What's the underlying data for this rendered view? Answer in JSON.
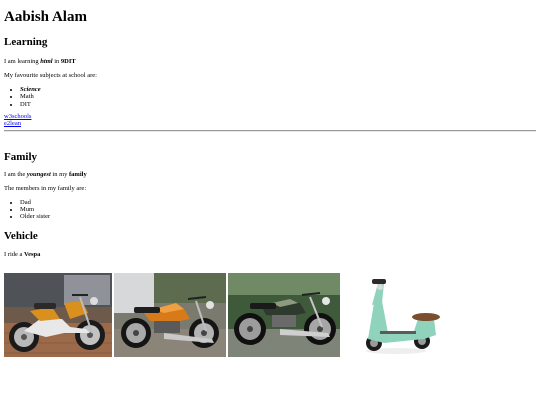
{
  "header": {
    "name": "Aabish Alam"
  },
  "learning": {
    "heading": "Learning",
    "line1_pre": "I am learning ",
    "line1_em": "html",
    "line1_mid": " in ",
    "line1_strong": "9DIT",
    "line2": "My favourite subjects at school are:",
    "subjects": [
      "Science",
      "Math",
      "DIT"
    ],
    "links": [
      "w3schools",
      "e2lean"
    ]
  },
  "family": {
    "heading": "Family",
    "line1_pre": "I am the ",
    "line1_em": "youngest",
    "line1_mid": " in my ",
    "line1_strong": "family",
    "line2": "The members in my family are:",
    "members": [
      "Dad",
      "Mum",
      "Older sister"
    ]
  },
  "vehicle": {
    "heading": "Vehicle",
    "line_pre": "I ride a ",
    "line_strong": "Vespa"
  },
  "colors": {
    "link": "#0000ee",
    "bike1_tank": "#d9901f",
    "bike2_tank": "#d97a1a",
    "bike3_tank": "#2f3a2e",
    "vespa_body": "#8fd3bd"
  },
  "images": [
    {
      "icon": "orange-step-through-motorbike"
    },
    {
      "icon": "orange-classic-motorbike"
    },
    {
      "icon": "green-classic-motorbike"
    },
    {
      "icon": "mint-vespa-scooter"
    }
  ]
}
